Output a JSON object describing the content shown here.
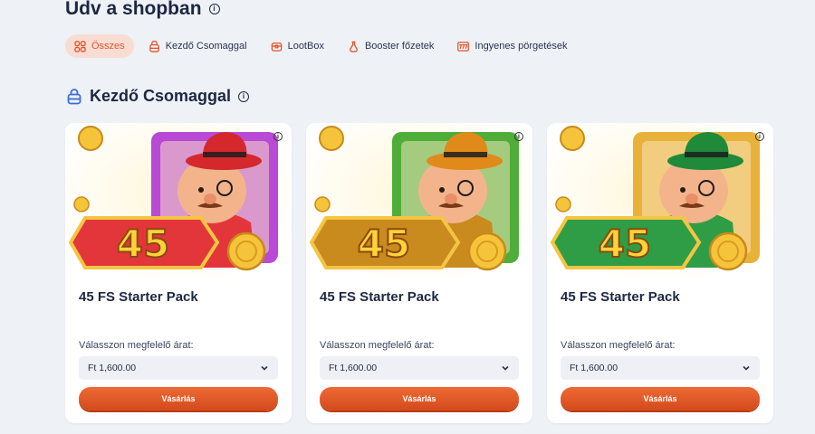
{
  "header": {
    "title": "Üdv a shopban"
  },
  "tabs": [
    {
      "label": "Összes",
      "icon": "grid-icon",
      "active": true
    },
    {
      "label": "Kezdő Csomaggal",
      "icon": "starter-pack-icon"
    },
    {
      "label": "LootBox",
      "icon": "lootbox-icon"
    },
    {
      "label": "Booster főzetek",
      "icon": "potion-icon"
    },
    {
      "label": "Ingyenes pörgetések",
      "icon": "slot-777-icon"
    }
  ],
  "section": {
    "title": "Kezdő Csomaggal",
    "icon": "starter-pack-icon"
  },
  "cards": [
    {
      "name": "45 FS Starter Pack",
      "badge": "45",
      "price_label": "Válasszon megfelelő árat:",
      "price": "Ft 1,600.00",
      "buy_label": "Vásárlás",
      "theme": "#e3363a",
      "frame": "#b84ad6",
      "hat": "#d4282d"
    },
    {
      "name": "45 FS Starter Pack",
      "badge": "45",
      "price_label": "Válasszon megfelelő árat:",
      "price": "Ft 1,600.00",
      "buy_label": "Vásárlás",
      "theme": "#c98a1e",
      "frame": "#4fae3a",
      "hat": "#e08a1a"
    },
    {
      "name": "45 FS Starter Pack",
      "badge": "45",
      "price_label": "Válasszon megfelelő árat:",
      "price": "Ft 1,600.00",
      "buy_label": "Vásárlás",
      "theme": "#2f9d45",
      "frame": "#e8b23a",
      "hat": "#1f8a3a"
    }
  ],
  "colors": {
    "accent": "#e2532a",
    "tab_active_bg": "#f9ddd3"
  }
}
